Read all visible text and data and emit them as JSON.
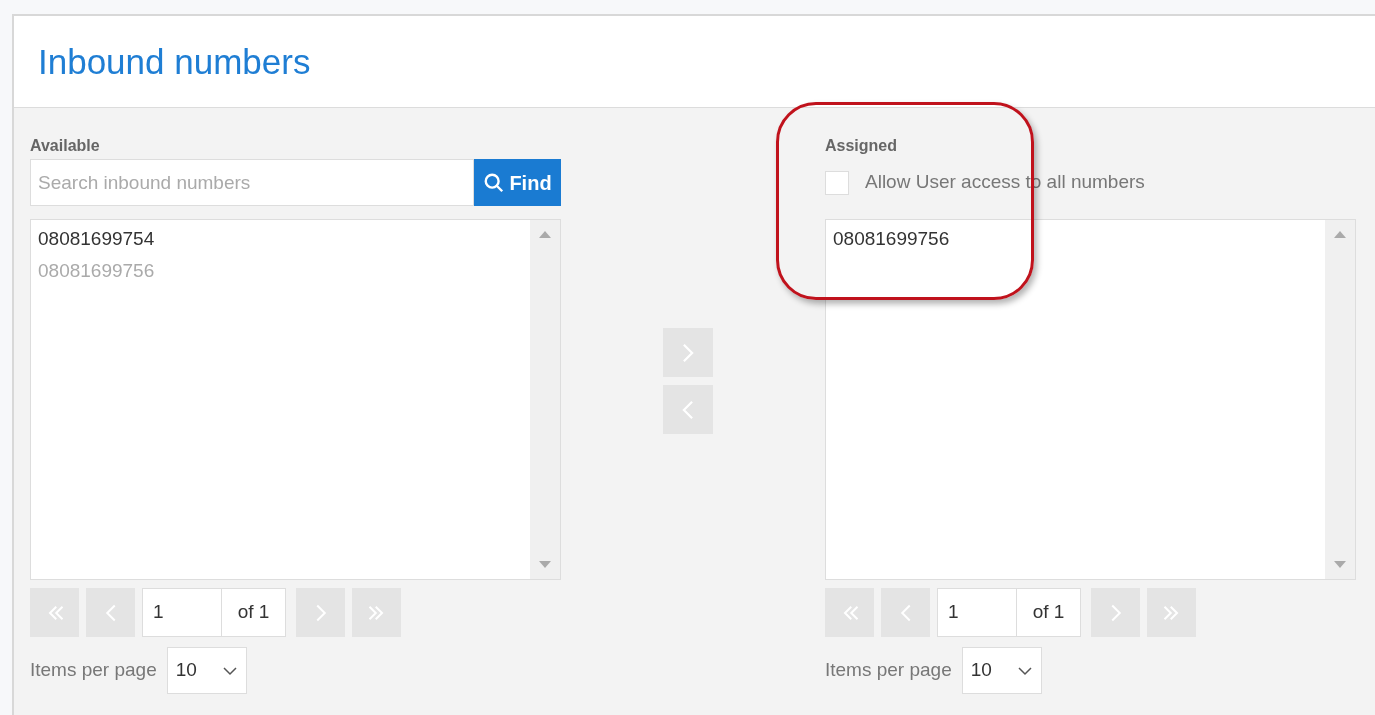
{
  "page": {
    "title": "Inbound numbers"
  },
  "available": {
    "label": "Available",
    "search": {
      "placeholder": "Search inbound numbers"
    },
    "find_button": "Find",
    "items": [
      {
        "text": "08081699754",
        "disabled": false
      },
      {
        "text": "08081699756",
        "disabled": true
      }
    ],
    "pager": {
      "page": "1",
      "of": "of 1",
      "first_disabled": true,
      "prev_disabled": true,
      "next_disabled": true,
      "last_disabled": true
    },
    "items_per_page": {
      "label": "Items per page",
      "value": "10"
    }
  },
  "move_buttons": [
    {
      "kind": "right",
      "disabled": true
    },
    {
      "kind": "left",
      "disabled": true
    }
  ],
  "assigned": {
    "label": "Assigned",
    "allow_all": {
      "label": "Allow User access to all numbers",
      "checked": false
    },
    "items": [
      {
        "text": "08081699756",
        "disabled": false
      }
    ],
    "pager": {
      "page": "1",
      "of": "of 1",
      "first_disabled": true,
      "prev_disabled": true,
      "next_disabled": true,
      "last_disabled": true
    },
    "items_per_page": {
      "label": "Items per page",
      "value": "10"
    }
  }
}
